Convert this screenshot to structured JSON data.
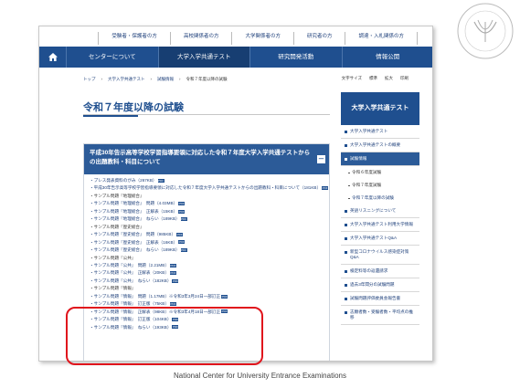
{
  "header": {
    "toplinks": [
      "受験者・保護者の方",
      "高校関係者の方",
      "大学関係者の方",
      "研究者の方",
      "調達・入札関係の方"
    ],
    "nav": [
      "センターについて",
      "大学入学共通テスト",
      "研究開発活動",
      "情報公開"
    ]
  },
  "breadcrumb": [
    "トップ",
    "大学入学共通テスト",
    "試験情報",
    "令和７年度以降の試験"
  ],
  "font_size": {
    "label": "文字サイズ",
    "standard": "標準",
    "large": "拡大",
    "print": "印刷"
  },
  "page_title": "令和７年度以降の試験",
  "panel": {
    "title": "平成30年告示高等学校学習指導要領に対応した令和７年度大学入学共通テストからの出題教科・科目について",
    "collapse": "－",
    "items": [
      {
        "text": "プレス発表資料のがみ（267KB）",
        "pdf": true
      },
      {
        "text": "平成30年告示高等学校学習指導要領に対応した令和７年度大学入学共通テストからの出題教科・科目について（181KB）",
        "pdf": true
      },
      {
        "text": "サンプル問題『地理総合』",
        "pdf": false
      },
      {
        "text": "サンプル問題『地理総合』　問題（4.03MB）",
        "pdf": true
      },
      {
        "text": "サンプル問題『地理総合』　正解表（15KB）",
        "pdf": true
      },
      {
        "text": "サンプル問題『地理総合』　ねらい（189KB）",
        "pdf": true
      },
      {
        "text": "サンプル問題『歴史総合』",
        "pdf": false
      },
      {
        "text": "サンプル問題『歴史総合』　問題（985KB）",
        "pdf": true
      },
      {
        "text": "サンプル問題『歴史総合』　正解表（16KB）",
        "pdf": true
      },
      {
        "text": "サンプル問題『歴史総合』　ねらい（189KB）",
        "pdf": true
      },
      {
        "text": "サンプル問題『公共』",
        "pdf": false
      },
      {
        "text": "サンプル問題『公共』　問題（2.21MB）",
        "pdf": true
      },
      {
        "text": "サンプル問題『公共』　正解表（20KB）",
        "pdf": true
      },
      {
        "text": "サンプル問題『公共』　ねらい（182KB）",
        "pdf": true
      },
      {
        "text": "サンプル問題『情報』",
        "pdf": false
      },
      {
        "text": "サンプル問題『情報』　問題（1.17MB）※令和3年3月24日一部訂正",
        "pdf": true
      },
      {
        "text": "サンプル問題『情報』　訂正版（75KB）",
        "pdf": true
      },
      {
        "text": "サンプル問題『情報』　正解表（98KB）※令和3年4月18日一部訂正",
        "pdf": true
      },
      {
        "text": "サンプル問題『情報』　訂正版（104KB）",
        "pdf": true
      },
      {
        "text": "サンプル問題『情報』　ねらい（193KB）",
        "pdf": true
      }
    ]
  },
  "sidebar": {
    "title": "大学入学共通テスト",
    "items": [
      {
        "label": "大学入学共通テスト",
        "type": "main"
      },
      {
        "label": "大学入学共通テストの概要",
        "type": "main"
      },
      {
        "label": "試験情報",
        "type": "active"
      },
      {
        "label": "令和６年度試験",
        "type": "sub"
      },
      {
        "label": "令和７年度試験",
        "type": "sub"
      },
      {
        "label": "令和７年度以降の試験",
        "type": "subcur"
      },
      {
        "label": "英語リスニングについて",
        "type": "main"
      },
      {
        "label": "大学入学共通テスト利用大学情報",
        "type": "main"
      },
      {
        "label": "大学入学共通テストQ&A",
        "type": "main"
      },
      {
        "label": "新型コロナウイルス感染症対策Q&A",
        "type": "main"
      },
      {
        "label": "検定料等の返還請求",
        "type": "main"
      },
      {
        "label": "過去3年間分の試験問題",
        "type": "main"
      },
      {
        "label": "試験問題評価委員会報告書",
        "type": "main"
      },
      {
        "label": "志願者数・受験者数・平均点の推移",
        "type": "main"
      }
    ]
  },
  "caption": "National Center for University Entrance Examinations",
  "colors": {
    "nav": "#1f4f8f",
    "highlight": "#e0141c"
  },
  "icons": {
    "home": "home-icon",
    "seal": "logo-seal-icon"
  }
}
